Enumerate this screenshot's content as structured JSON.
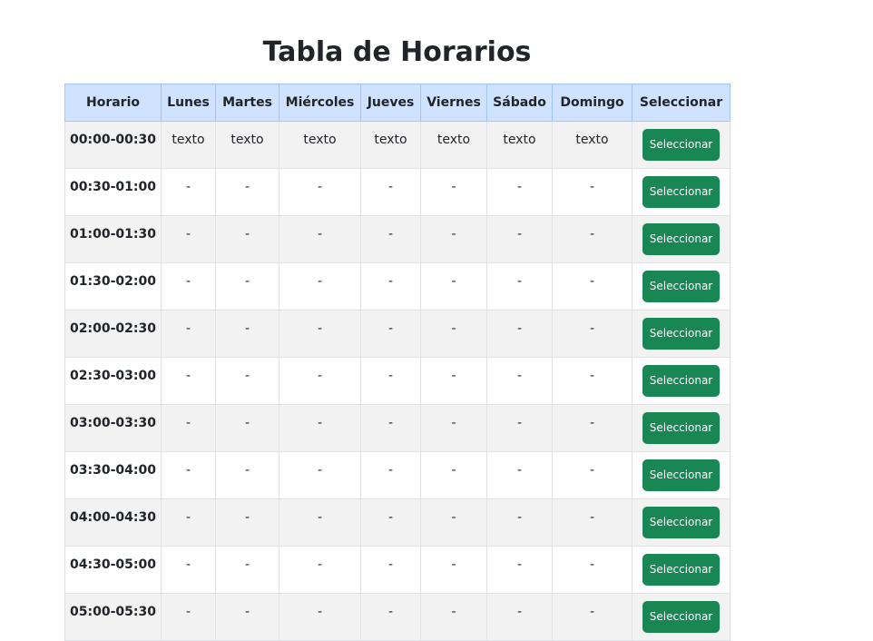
{
  "page": {
    "title": "Tabla de Horarios"
  },
  "table": {
    "headers": [
      "Horario",
      "Lunes",
      "Martes",
      "Miércoles",
      "Jueves",
      "Viernes",
      "Sábado",
      "Domingo",
      "Seleccionar"
    ],
    "button_label": "Seleccionar",
    "rows": [
      {
        "time": "00:00-00:30",
        "cells": [
          "texto",
          "texto",
          "texto",
          "texto",
          "texto",
          "texto",
          "texto"
        ]
      },
      {
        "time": "00:30-01:00",
        "cells": [
          "-",
          "-",
          "-",
          "-",
          "-",
          "-",
          "-"
        ]
      },
      {
        "time": "01:00-01:30",
        "cells": [
          "-",
          "-",
          "-",
          "-",
          "-",
          "-",
          "-"
        ]
      },
      {
        "time": "01:30-02:00",
        "cells": [
          "-",
          "-",
          "-",
          "-",
          "-",
          "-",
          "-"
        ]
      },
      {
        "time": "02:00-02:30",
        "cells": [
          "-",
          "-",
          "-",
          "-",
          "-",
          "-",
          "-"
        ]
      },
      {
        "time": "02:30-03:00",
        "cells": [
          "-",
          "-",
          "-",
          "-",
          "-",
          "-",
          "-"
        ]
      },
      {
        "time": "03:00-03:30",
        "cells": [
          "-",
          "-",
          "-",
          "-",
          "-",
          "-",
          "-"
        ]
      },
      {
        "time": "03:30-04:00",
        "cells": [
          "-",
          "-",
          "-",
          "-",
          "-",
          "-",
          "-"
        ]
      },
      {
        "time": "04:00-04:30",
        "cells": [
          "-",
          "-",
          "-",
          "-",
          "-",
          "-",
          "-"
        ]
      },
      {
        "time": "04:30-05:00",
        "cells": [
          "-",
          "-",
          "-",
          "-",
          "-",
          "-",
          "-"
        ]
      },
      {
        "time": "05:00-05:30",
        "cells": [
          "-",
          "-",
          "-",
          "-",
          "-",
          "-",
          "-"
        ]
      }
    ]
  },
  "colors": {
    "header_bg": "#cfe2ff",
    "button_bg": "#198754",
    "stripe_bg": "#f2f2f2"
  }
}
